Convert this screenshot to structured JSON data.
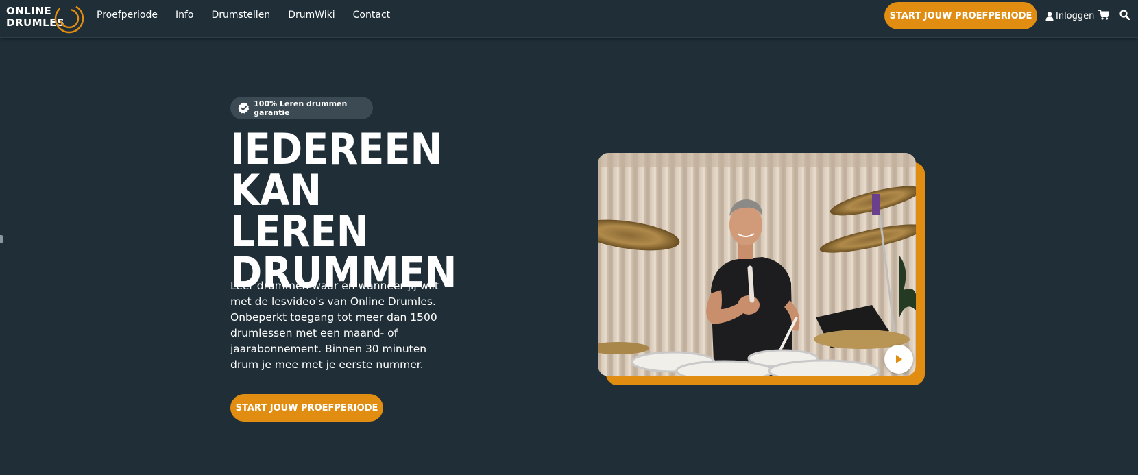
{
  "header": {
    "logo": {
      "line1": "ONLINE",
      "line2": "DRUMLES"
    },
    "nav": [
      {
        "label": "Proefperiode"
      },
      {
        "label": "Info"
      },
      {
        "label": "Drumstellen"
      },
      {
        "label": "DrumWiki"
      },
      {
        "label": "Contact"
      }
    ],
    "cta_label": "START JOUW PROEFPERIODE",
    "login_label": "Inloggen",
    "icons": [
      "user-icon",
      "cart-icon",
      "search-icon"
    ]
  },
  "hero": {
    "badge_label": "100% Leren drummen garantie",
    "title_lines": [
      "IEDEREEN KAN",
      "LEREN",
      "DRUMMEN"
    ],
    "text": "Leer drummen waar en wanneer jij wilt met de lesvideo's van Online Drumles. Onbeperkt toegang tot meer dan 1500 drumlessen met een maand- of jaarabonnement. Binnen 30 minuten drum je mee met je eerste nummer.",
    "cta_label": "START JOUW PROEFPERIODE"
  },
  "colors": {
    "background": "#1f2e37",
    "accent": "#e08d12",
    "badge_bg": "#3c4a53",
    "text": "#ffffff"
  }
}
